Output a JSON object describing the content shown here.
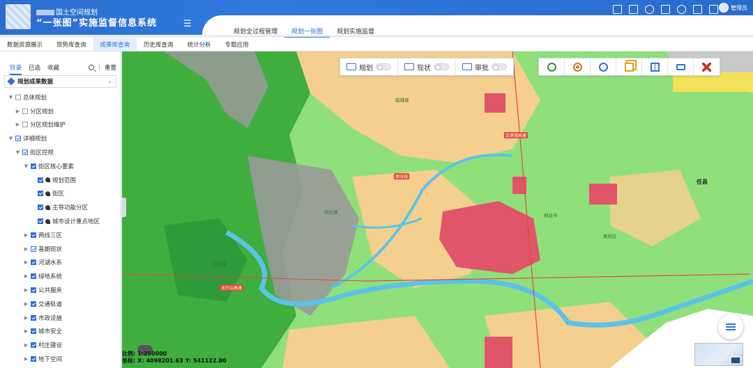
{
  "header": {
    "title_line1": "国土空间规划",
    "title_line2": "“一张图”实施监督信息系统",
    "menu_icon": "menu-icon",
    "user_name": "管理员",
    "icons": [
      "report-icon",
      "tree-icon",
      "bell-icon",
      "mail-icon",
      "globe-icon",
      "list-icon",
      "fullscreen-icon"
    ]
  },
  "module_tabs": [
    {
      "label": "规划全过程管理"
    },
    {
      "label": "规划一张图"
    },
    {
      "label": "规划实施监督"
    }
  ],
  "sub_tabs": [
    {
      "label": "数据资源展示"
    },
    {
      "label": "现势库查询"
    },
    {
      "label": "成果库查询"
    },
    {
      "label": "历史库查询"
    },
    {
      "label": "统计分析"
    },
    {
      "label": "专题应用"
    }
  ],
  "sidebar": {
    "tabs": [
      {
        "label": "目录"
      },
      {
        "label": "已选"
      },
      {
        "label": "收藏"
      }
    ],
    "reset_label": "重置",
    "divider": "|",
    "selector_label": "规划成果数据",
    "tree": [
      {
        "label": "总体规划"
      },
      {
        "label": "分区规划"
      },
      {
        "label": "分区规划维护"
      },
      {
        "label": "详细规划"
      },
      {
        "label": "街区控规"
      },
      {
        "label": "街区核心要素"
      },
      {
        "label": "规划范围"
      },
      {
        "label": "街区"
      },
      {
        "label": "主导功能分区"
      },
      {
        "label": "城市设计重点地区"
      },
      {
        "label": "两线三区"
      },
      {
        "label": "基期现状"
      },
      {
        "label": "河湖水系"
      },
      {
        "label": "绿地系统"
      },
      {
        "label": "公共服务"
      },
      {
        "label": "交通轨道"
      },
      {
        "label": "市政设施"
      },
      {
        "label": "城市安全"
      },
      {
        "label": "村庄建设"
      },
      {
        "label": "地下空间"
      }
    ]
  },
  "map_toolbar": {
    "toggles": [
      {
        "label": "规划"
      },
      {
        "label": "现状"
      },
      {
        "label": "审批"
      }
    ],
    "tools": [
      "zoom-icon",
      "target-icon",
      "clock-icon",
      "layers-icon",
      "split-screen-icon",
      "print-icon",
      "tools-icon"
    ]
  },
  "map_status": {
    "scale_label": "比例:",
    "scale_value": "1:250000",
    "coord_label": "坐标:",
    "x_label": "X:",
    "x_value": "4098201.63",
    "y_label": "Y:",
    "y_value": "541122.80"
  },
  "map_labels": {
    "town": "任县",
    "road1": "京港澳高速",
    "road2": "邢汾线",
    "road3": "太行山高速",
    "place1": "临城县",
    "place2": "内丘县",
    "place3": "邢台市",
    "place4": "沙河市",
    "place5": "南和区"
  },
  "colors": {
    "brand": "#2f6fd6",
    "urban": "#e0556a",
    "farmland": "#f4cf8e",
    "forest": "#3fae3f",
    "grass": "#8fe07a",
    "water": "#5bc3e8",
    "mountain": "#9a9a9a"
  }
}
